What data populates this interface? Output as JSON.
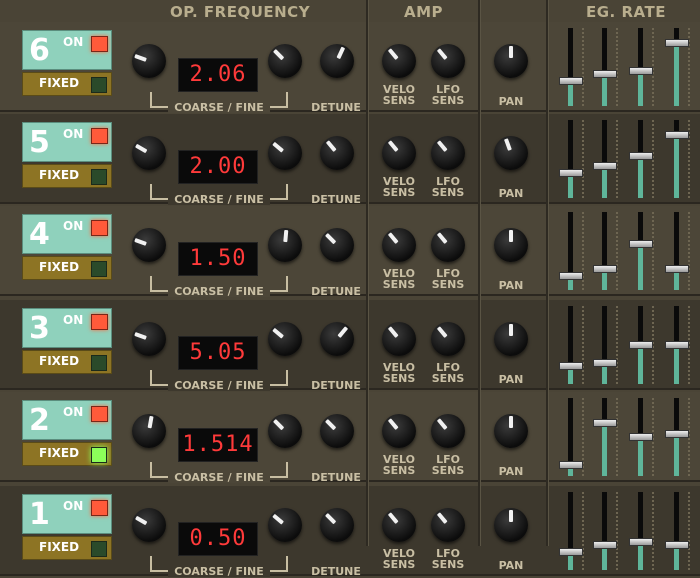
{
  "header": {
    "op_frequency": "OP. FREQUENCY",
    "amp": "AMP",
    "eg_rate": "EG. RATE"
  },
  "labels": {
    "on": "ON",
    "fixed": "FIXED",
    "coarse_fine": "COARSE / FINE",
    "detune": "DETUNE",
    "velo_sens_1": "VELO",
    "velo_sens_2": "SENS",
    "lfo_sens_1": "LFO",
    "lfo_sens_2": "SENS",
    "pan": "PAN"
  },
  "colors": {
    "on_panel": "#8fd1bc",
    "fixed_panel": "#8d7424",
    "led_on": "#ff5a3a",
    "led_fixed_lit": "#8cff5a",
    "display_text": "#ff3a3a",
    "slider_fill": "#5fb59a"
  },
  "operators": [
    {
      "number": "6",
      "on": true,
      "fixed": false,
      "frequency": "2.06",
      "knobs": {
        "coarse": -70,
        "fine": -45,
        "detune": 25,
        "velo_sens": -40,
        "lfo_sens": -40,
        "pan": 0
      },
      "eg_rate": [
        0.3,
        0.4,
        0.45,
        0.85
      ]
    },
    {
      "number": "5",
      "on": true,
      "fixed": false,
      "frequency": "2.00",
      "knobs": {
        "coarse": -60,
        "fine": -50,
        "detune": -40,
        "velo_sens": -40,
        "lfo_sens": -40,
        "pan": -20
      },
      "eg_rate": [
        0.3,
        0.4,
        0.55,
        0.85
      ]
    },
    {
      "number": "4",
      "on": true,
      "fixed": false,
      "frequency": "1.50",
      "knobs": {
        "coarse": -70,
        "fine": 5,
        "detune": -45,
        "velo_sens": -40,
        "lfo_sens": -40,
        "pan": 0
      },
      "eg_rate": [
        0.15,
        0.25,
        0.6,
        0.25
      ]
    },
    {
      "number": "3",
      "on": true,
      "fixed": false,
      "frequency": "5.05",
      "knobs": {
        "coarse": -70,
        "fine": -50,
        "detune": 40,
        "velo_sens": -40,
        "lfo_sens": -40,
        "pan": 0
      },
      "eg_rate": [
        0.2,
        0.25,
        0.5,
        0.5
      ]
    },
    {
      "number": "2",
      "on": true,
      "fixed": true,
      "frequency": "1.514",
      "knobs": {
        "coarse": 10,
        "fine": -45,
        "detune": -45,
        "velo_sens": -40,
        "lfo_sens": -40,
        "pan": 0
      },
      "eg_rate": [
        0.1,
        0.7,
        0.5,
        0.55
      ]
    },
    {
      "number": "1",
      "on": true,
      "fixed": false,
      "frequency": "0.50",
      "knobs": {
        "coarse": -60,
        "fine": -50,
        "detune": -45,
        "velo_sens": -40,
        "lfo_sens": -40,
        "pan": 0
      },
      "eg_rate": [
        0.2,
        0.3,
        0.35,
        0.3
      ]
    }
  ]
}
